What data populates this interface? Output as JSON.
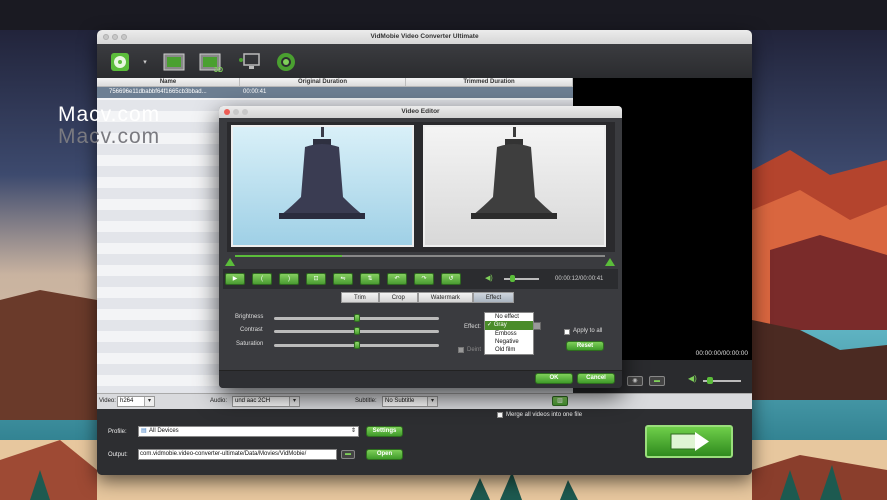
{
  "watermark": {
    "line1": "Macv.com",
    "line2": "Macv.com"
  },
  "window": {
    "title": "VidMobie Video Converter Ultimate"
  },
  "toolbar": {
    "icons": [
      "add-file-icon",
      "dropdown-arrow-icon",
      "edit-video-icon",
      "3d-icon",
      "screen-record-icon",
      "settings-ring-icon"
    ],
    "label_3d": "3D"
  },
  "table": {
    "columns": [
      "Name",
      "Original Duration",
      "Trimmed Duration"
    ],
    "rows": [
      {
        "name": "756696e11dbabbf64f1665cb3bbad...",
        "original": "00:00:41",
        "trimmed": ""
      }
    ]
  },
  "preview": {
    "time": "00:00:00/00:00:00"
  },
  "bottom": {
    "video_label": "Video:",
    "video_value": "h264",
    "audio_label": "Audio:",
    "audio_value": "und aac 2CH",
    "subtitle_label": "Subtitle:",
    "subtitle_value": "No Subtitle",
    "merge_label": "Merge all videos into one file"
  },
  "output": {
    "profile_label": "Profile:",
    "profile_value": "All Devices",
    "settings_btn": "Settings",
    "output_label": "Output:",
    "output_value": "com.vidmobie.video-converter-ultimate/Data/Movies/VidMobie/",
    "open_btn": "Open"
  },
  "dialog": {
    "title": "Video Editor",
    "time": "00:00:12/00:00:41",
    "tabs": [
      "Trim",
      "Crop",
      "Watermark",
      "Effect"
    ],
    "active_tab": "Effect",
    "brightness_label": "Brightness",
    "contrast_label": "Contrast",
    "saturation_label": "Saturation",
    "brightness": 0.5,
    "contrast": 0.5,
    "saturation": 0.5,
    "effect_label": "Effect:",
    "effect_options": [
      "No effect",
      "✓ Gray",
      "Emboss",
      "Negative",
      "Old film"
    ],
    "selected_effect": "Gray",
    "apply_all_label": "Apply to all",
    "reset_btn": "Reset",
    "deint_label": "Deint",
    "ok_btn": "OK",
    "cancel_btn": "Cancel",
    "progress": 0.29
  }
}
